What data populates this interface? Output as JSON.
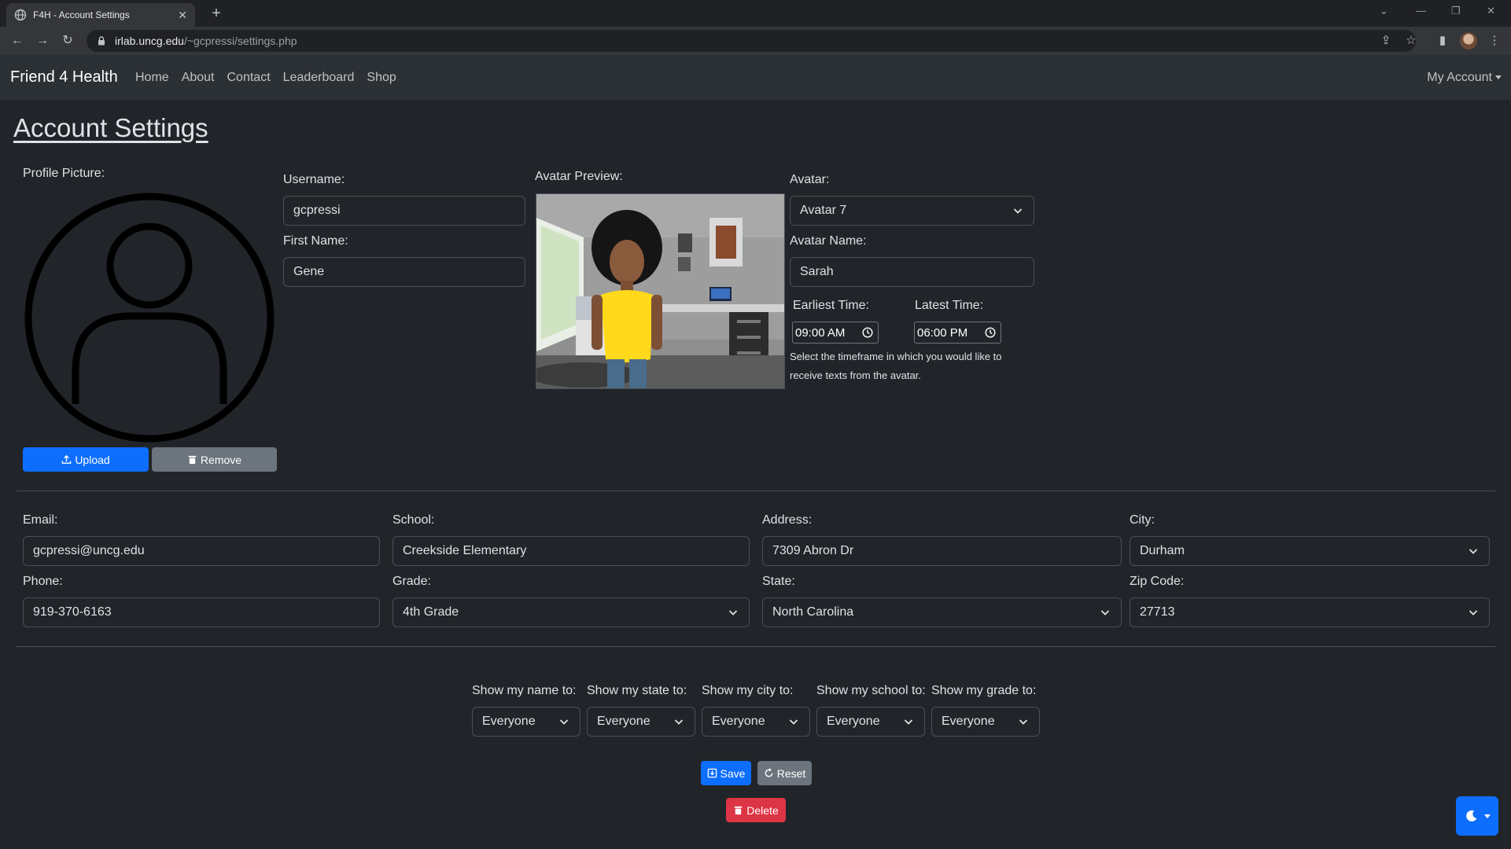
{
  "browser": {
    "tab_title": "F4H - Account Settings",
    "url_host": "irlab.uncg.edu",
    "url_path": "/~gcpressi/settings.php"
  },
  "nav": {
    "brand": "Friend 4 Health",
    "links": [
      "Home",
      "About",
      "Contact",
      "Leaderboard",
      "Shop"
    ],
    "account": "My Account"
  },
  "page": {
    "title": "Account Settings"
  },
  "profile": {
    "label": "Profile Picture:",
    "upload_label": "Upload",
    "remove_label": "Remove"
  },
  "form": {
    "username": {
      "label": "Username:",
      "value": "gcpressi"
    },
    "first_name": {
      "label": "First Name:",
      "value": "Gene"
    },
    "avatar_preview_label": "Avatar Preview:",
    "avatar": {
      "label": "Avatar:",
      "value": "Avatar 7"
    },
    "avatar_name": {
      "label": "Avatar Name:",
      "value": "Sarah"
    },
    "earliest_time": {
      "label": "Earliest Time:",
      "value": "09:00 AM"
    },
    "latest_time": {
      "label": "Latest Time:",
      "value": "06:00 PM"
    },
    "time_help": [
      "Select the timeframe in which you would like to",
      "receive texts from the avatar."
    ],
    "email": {
      "label": "Email:",
      "value": "gcpressi@uncg.edu"
    },
    "school": {
      "label": "School:",
      "value": "Creekside Elementary"
    },
    "address": {
      "label": "Address:",
      "value": "7309 Abron Dr"
    },
    "city": {
      "label": "City:",
      "value": "Durham"
    },
    "phone": {
      "label": "Phone:",
      "value": "919-370-6163"
    },
    "grade": {
      "label": "Grade:",
      "value": "4th Grade"
    },
    "state": {
      "label": "State:",
      "value": "North Carolina"
    },
    "zip": {
      "label": "Zip Code:",
      "value": "27713"
    }
  },
  "privacy": [
    {
      "label": "Show my name to:",
      "value": "Everyone"
    },
    {
      "label": "Show my state to:",
      "value": "Everyone"
    },
    {
      "label": "Show my city to:",
      "value": "Everyone"
    },
    {
      "label": "Show my school to:",
      "value": "Everyone"
    },
    {
      "label": "Show my grade to:",
      "value": "Everyone"
    }
  ],
  "actions": {
    "save_label": "Save",
    "reset_label": "Reset",
    "delete_label": "Delete"
  },
  "colors": {
    "primary": "#0d6efd",
    "secondary": "#6c757d",
    "danger": "#dc3545",
    "background": "#212529"
  }
}
